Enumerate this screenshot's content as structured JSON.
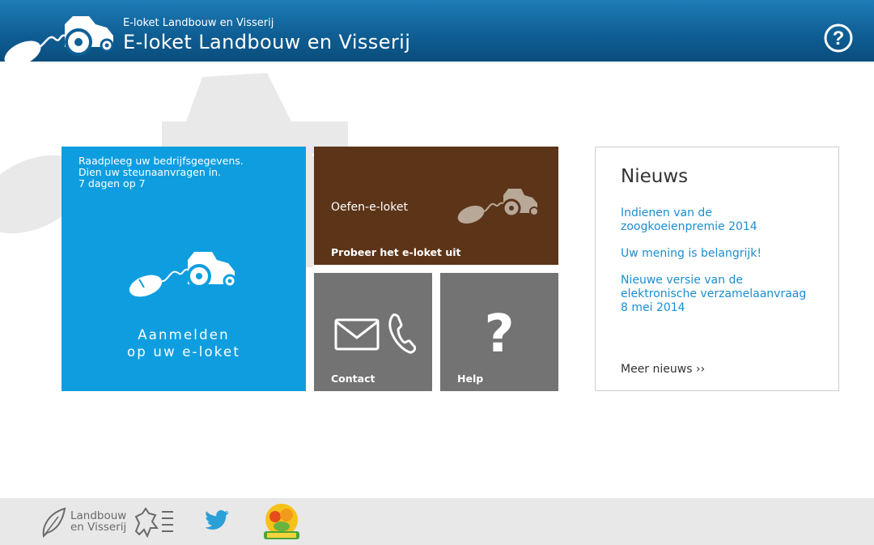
{
  "header": {
    "subtitle": "E-loket Landbouw en Visserij",
    "title": "E-loket Landbouw en Visserij",
    "help_icon": "help-circle-icon",
    "colors": {
      "top": "#1f7cb6",
      "bottom": "#0a4d7c"
    }
  },
  "tiles": {
    "main": {
      "intro": [
        "Raadpleeg uw bedrijfsgegevens.",
        "Dien uw steunaanvragen in.",
        "7 dagen op 7"
      ],
      "label": [
        "Aanmelden",
        "op uw e-loket"
      ],
      "icon": "mouse-tractor-icon",
      "color": "#0e9ee0"
    },
    "oefen": {
      "title": "Oefen-e-loket",
      "subtitle": "Probeer het e-loket uit",
      "icon": "mouse-tractor-icon",
      "color": "#5c3418"
    },
    "contact": {
      "label": "Contact",
      "icons": [
        "envelope-icon",
        "phone-icon"
      ],
      "color": "#737373"
    },
    "help": {
      "label": "Help",
      "symbol": "?",
      "color": "#737373"
    }
  },
  "news": {
    "title": "Nieuws",
    "items": [
      [
        "Indienen van de",
        "zoogkoeienpremie 2014"
      ],
      [
        "Uw mening is belangrijk!"
      ],
      [
        "Nieuwe versie van de",
        "elektronische verzamelaanvraag",
        "8 mei 2014"
      ]
    ],
    "more": "Meer nieuws ››",
    "link_color": "#1b8ed0"
  },
  "footer": {
    "lv_logo": [
      "Landbouw",
      "en Visserij"
    ],
    "icons": [
      "landbouw-en-visserij-logo",
      "flanders-lion-icon",
      "twitter-icon",
      "tutti-frutti-logo"
    ]
  }
}
